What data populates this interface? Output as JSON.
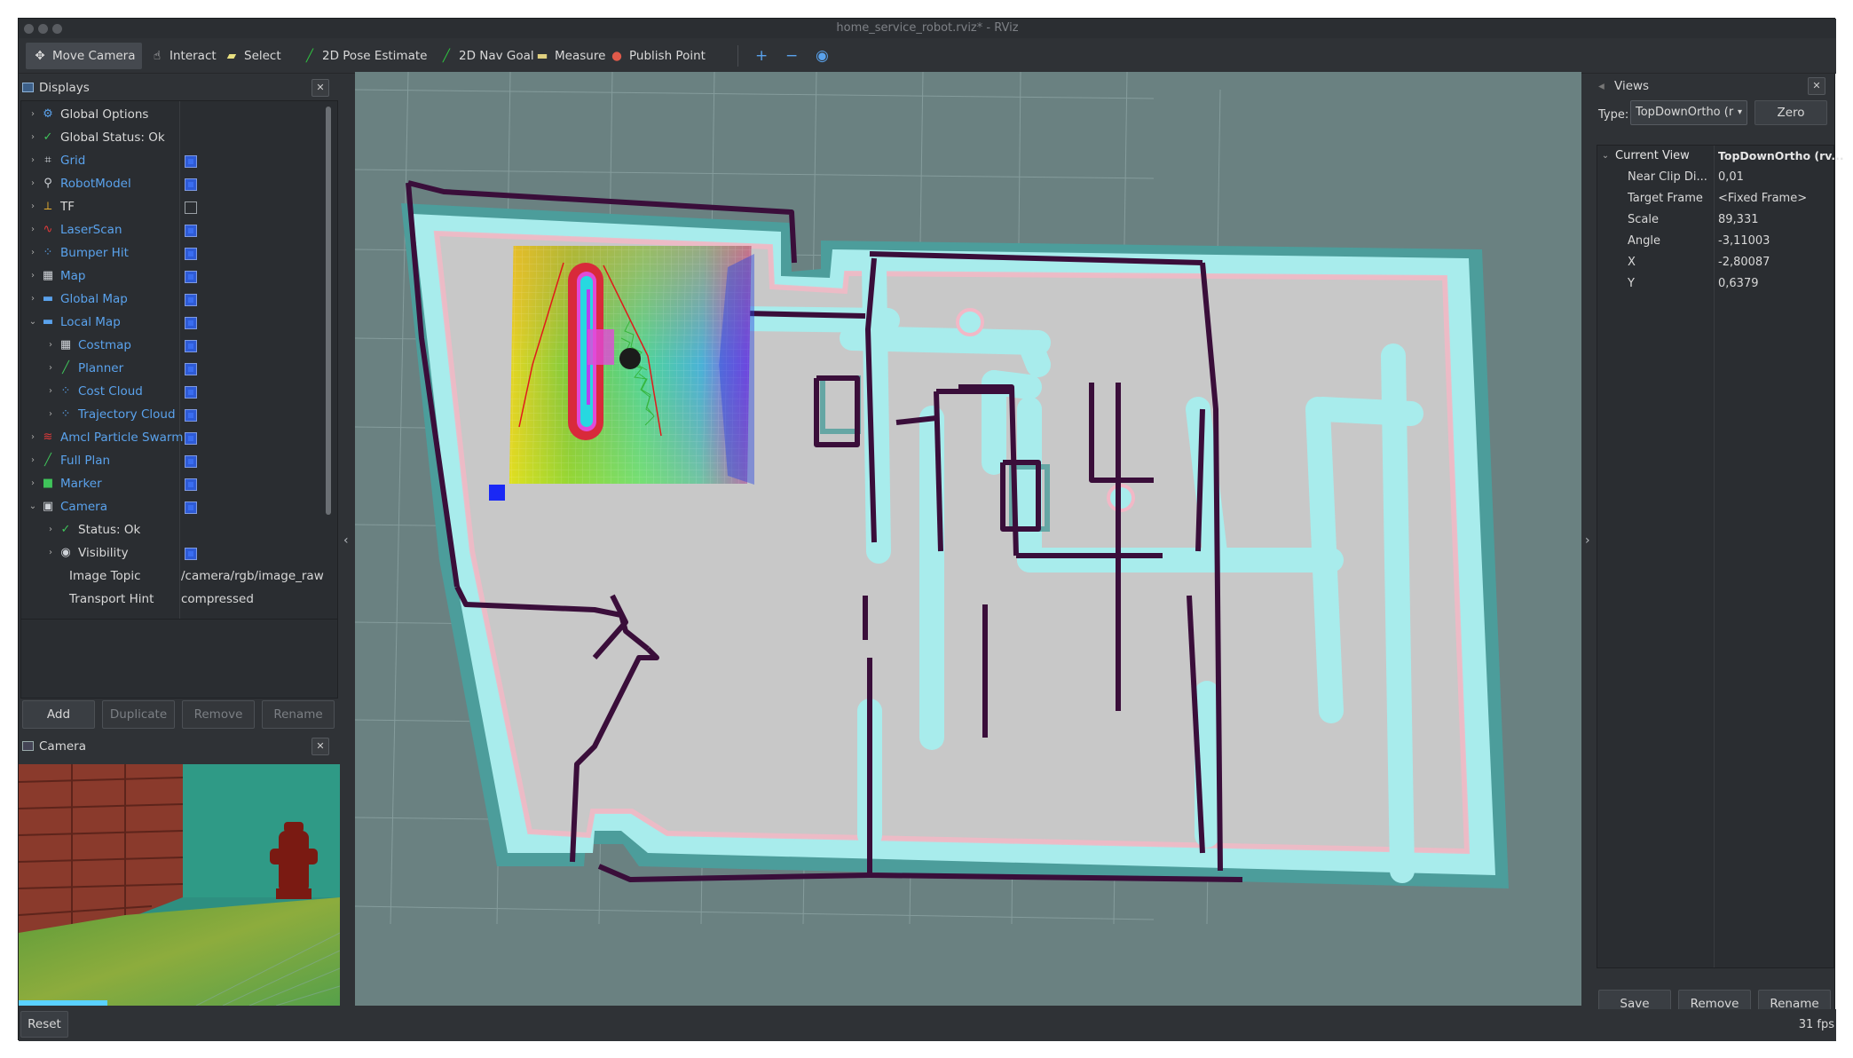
{
  "window": {
    "title": "home_service_robot.rviz* - RViz"
  },
  "toolbar": {
    "tools": [
      {
        "label": "Move Camera",
        "icon": "move-camera-icon",
        "active": true
      },
      {
        "label": "Interact",
        "icon": "interact-hand-icon"
      },
      {
        "label": "Select",
        "icon": "select-icon"
      },
      {
        "label": "2D Pose Estimate",
        "icon": "pose-estimate-arrow-icon"
      },
      {
        "label": "2D Nav Goal",
        "icon": "nav-goal-arrow-icon"
      },
      {
        "label": "Measure",
        "icon": "measure-ruler-icon"
      },
      {
        "label": "Publish Point",
        "icon": "publish-point-pin-icon"
      }
    ],
    "extra_icons": [
      "plus-icon",
      "minus-icon",
      "eye-icon"
    ]
  },
  "displays": {
    "title": "Displays",
    "items": [
      {
        "label": "Global Options",
        "icon": "gear-icon",
        "depth": 0,
        "expand": "collapsed",
        "blue": false,
        "checkbox": null,
        "value": ""
      },
      {
        "label": "Global Status: Ok",
        "icon": "check-icon",
        "depth": 0,
        "expand": "collapsed",
        "blue": false,
        "checkbox": null,
        "value": ""
      },
      {
        "label": "Grid",
        "icon": "grid-icon",
        "depth": 0,
        "expand": "collapsed",
        "blue": true,
        "checkbox": true,
        "value": ""
      },
      {
        "label": "RobotModel",
        "icon": "robot-icon",
        "depth": 0,
        "expand": "collapsed",
        "blue": true,
        "checkbox": true,
        "value": ""
      },
      {
        "label": "TF",
        "icon": "tf-axes-icon",
        "depth": 0,
        "expand": "collapsed",
        "blue": false,
        "checkbox": false,
        "value": ""
      },
      {
        "label": "LaserScan",
        "icon": "laser-scan-icon",
        "depth": 0,
        "expand": "collapsed",
        "blue": true,
        "checkbox": true,
        "value": ""
      },
      {
        "label": "Bumper Hit",
        "icon": "point-cloud-icon",
        "depth": 0,
        "expand": "collapsed",
        "blue": true,
        "checkbox": true,
        "value": ""
      },
      {
        "label": "Map",
        "icon": "map-icon",
        "depth": 0,
        "expand": "collapsed",
        "blue": true,
        "checkbox": true,
        "value": ""
      },
      {
        "label": "Global Map",
        "icon": "folder-icon",
        "depth": 0,
        "expand": "collapsed",
        "blue": true,
        "checkbox": true,
        "value": ""
      },
      {
        "label": "Local Map",
        "icon": "folder-icon",
        "depth": 0,
        "expand": "expanded",
        "blue": true,
        "checkbox": true,
        "value": ""
      },
      {
        "label": "Costmap",
        "icon": "map-icon",
        "depth": 1,
        "expand": "collapsed",
        "blue": true,
        "checkbox": true,
        "value": ""
      },
      {
        "label": "Planner",
        "icon": "path-icon",
        "depth": 1,
        "expand": "collapsed",
        "blue": true,
        "checkbox": true,
        "value": ""
      },
      {
        "label": "Cost Cloud",
        "icon": "point-cloud-icon",
        "depth": 1,
        "expand": "collapsed",
        "blue": true,
        "checkbox": true,
        "value": ""
      },
      {
        "label": "Trajectory Cloud",
        "icon": "point-cloud-icon",
        "depth": 1,
        "expand": "collapsed",
        "blue": true,
        "checkbox": true,
        "value": ""
      },
      {
        "label": "Amcl Particle Swarm",
        "icon": "pose-array-icon",
        "depth": 0,
        "expand": "collapsed",
        "blue": true,
        "checkbox": true,
        "value": ""
      },
      {
        "label": "Full Plan",
        "icon": "path-icon",
        "depth": 0,
        "expand": "collapsed",
        "blue": true,
        "checkbox": true,
        "value": ""
      },
      {
        "label": "Marker",
        "icon": "marker-cube-icon",
        "depth": 0,
        "expand": "collapsed",
        "blue": true,
        "checkbox": true,
        "value": ""
      },
      {
        "label": "Camera",
        "icon": "camera-icon",
        "depth": 0,
        "expand": "expanded",
        "blue": true,
        "checkbox": true,
        "value": ""
      },
      {
        "label": "Status: Ok",
        "icon": "check-icon",
        "depth": 1,
        "expand": "collapsed",
        "blue": false,
        "checkbox": null,
        "value": ""
      },
      {
        "label": "Visibility",
        "icon": "eye-icon",
        "depth": 1,
        "expand": "collapsed",
        "blue": false,
        "checkbox": true,
        "value": ""
      },
      {
        "label": "Image Topic",
        "icon": "",
        "depth": 1,
        "expand": "none",
        "blue": false,
        "checkbox": null,
        "value": "/camera/rgb/image_raw"
      },
      {
        "label": "Transport Hint",
        "icon": "",
        "depth": 1,
        "expand": "none",
        "blue": false,
        "checkbox": null,
        "value": "compressed"
      }
    ],
    "buttons": {
      "add": "Add",
      "duplicate": "Duplicate",
      "remove": "Remove",
      "rename": "Rename"
    }
  },
  "camera_panel": {
    "title": "Camera"
  },
  "views": {
    "title": "Views",
    "type_label": "Type:",
    "type_value": "TopDownOrtho (r",
    "zero": "Zero",
    "current_view": {
      "label": "Current View",
      "value": "TopDownOrtho (rv..."
    },
    "props": [
      {
        "label": "Near Clip Di...",
        "value": "0,01"
      },
      {
        "label": "Target Frame",
        "value": "<Fixed Frame>"
      },
      {
        "label": "Scale",
        "value": "89,331"
      },
      {
        "label": "Angle",
        "value": "-3,11003"
      },
      {
        "label": "X",
        "value": "-2,80087"
      },
      {
        "label": "Y",
        "value": "0,6379"
      }
    ],
    "buttons": {
      "save": "Save",
      "remove": "Remove",
      "rename": "Rename"
    }
  },
  "status": {
    "reset": "Reset",
    "fps": "31 fps"
  },
  "colors": {
    "background": "#2f3236",
    "viewport": "#6a8181",
    "link": "#5aa2ec",
    "checkbox": "#2e5bd6"
  }
}
